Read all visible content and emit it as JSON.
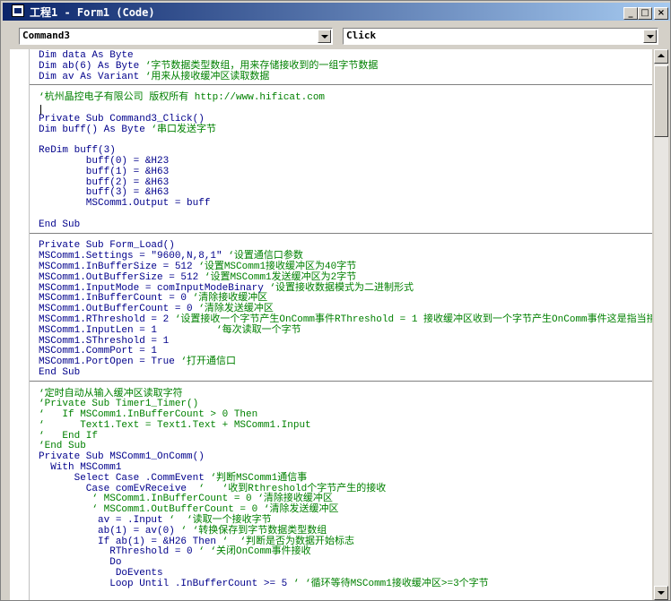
{
  "window": {
    "title": "工程1 - Form1 (Code)",
    "buttons": {
      "minimize": "_",
      "maximize": "□",
      "close": "×"
    }
  },
  "object_combo": {
    "value": "Command3"
  },
  "procedure_combo": {
    "value": "Click"
  },
  "code": {
    "sections": [
      [
        {
          "c": "Dim data As Byte",
          "t": "kw"
        },
        {
          "c": "Dim ab(6) As Byte ‘字节数据类型数组，用来存储接收到的一组字节数据",
          "t": "mix"
        },
        {
          "c": "Dim av As Variant ‘用来从接收缓冲区读取数据",
          "t": "mix"
        }
      ],
      [
        {
          "c": "",
          "t": "kw"
        },
        {
          "c": "‘杭州晶控电子有限公司 版权所有 http://www.hificat.com",
          "t": "cm"
        },
        {
          "c": "",
          "t": "kw"
        },
        {
          "c": "Private Sub Command3_Click()",
          "t": "kw"
        },
        {
          "c": "Dim buff() As Byte ‘串口发送字节",
          "t": "mix"
        },
        {
          "c": "",
          "t": "kw"
        },
        {
          "c": "ReDim buff(3)",
          "t": "kw"
        },
        {
          "c": "        buff(0) = &H23",
          "t": "kw"
        },
        {
          "c": "        buff(1) = &H63",
          "t": "kw"
        },
        {
          "c": "        buff(2) = &H63",
          "t": "kw"
        },
        {
          "c": "        buff(3) = &H63",
          "t": "kw"
        },
        {
          "c": "        MSComm1.Output = buff",
          "t": "kw"
        },
        {
          "c": "",
          "t": "kw"
        },
        {
          "c": "End Sub",
          "t": "kw"
        }
      ],
      [
        {
          "c": "",
          "t": "kw"
        },
        {
          "c": "Private Sub Form_Load()",
          "t": "kw"
        },
        {
          "c": "MSComm1.Settings = \"9600,N,8,1\" ‘设置通信口参数",
          "t": "mix"
        },
        {
          "c": "MSComm1.InBufferSize = 512 ‘设置MSComm1接收缓冲区为40字节",
          "t": "mix"
        },
        {
          "c": "MSComm1.OutBufferSize = 512 ‘设置MSComm1发送缓冲区为2字节",
          "t": "mix"
        },
        {
          "c": "MSComm1.InputMode = comInputModeBinary ‘设置接收数据模式为二进制形式",
          "t": "mix"
        },
        {
          "c": "MSComm1.InBufferCount = 0 ‘清除接收缓冲区",
          "t": "mix"
        },
        {
          "c": "MSComm1.OutBufferCount = 0 ‘清除发送缓冲区",
          "t": "mix"
        },
        {
          "c": "MSComm1.RThreshold = 2 ‘设置接收一个字节产生OnComm事件RThreshold = 1 接收缓冲区收到一个字节产生OnComm事件这是指当接",
          "t": "mix"
        },
        {
          "c": "MSComm1.InputLen = 1          ‘每次读取一个字节",
          "t": "mix"
        },
        {
          "c": "MSComm1.SThreshold = 1",
          "t": "kw"
        },
        {
          "c": "MSComm1.CommPort = 1",
          "t": "kw"
        },
        {
          "c": "MSComm1.PortOpen = True ‘打开通信口",
          "t": "mix"
        },
        {
          "c": "End Sub",
          "t": "kw"
        }
      ],
      [
        {
          "c": "",
          "t": "kw"
        },
        {
          "c": "‘定时自动从输入缓冲区读取字符",
          "t": "cm"
        },
        {
          "c": "‘Private Sub Timer1_Timer()",
          "t": "cm"
        },
        {
          "c": "‘   If MSComm1.InBufferCount > 0 Then",
          "t": "cm"
        },
        {
          "c": "‘      Text1.Text = Text1.Text + MSComm1.Input",
          "t": "cm"
        },
        {
          "c": "‘   End If",
          "t": "cm"
        },
        {
          "c": "‘End Sub",
          "t": "cm"
        },
        {
          "c": "Private Sub MSComm1_OnComm()",
          "t": "kw"
        },
        {
          "c": "  With MSComm1",
          "t": "kw"
        },
        {
          "c": "      Select Case .CommEvent ‘判断MSComm1通信事",
          "t": "mix"
        },
        {
          "c": "        Case comEvReceive  ‘   ‘收到Rthreshold个字节产生的接收",
          "t": "mix"
        },
        {
          "c": "         ‘ MSComm1.InBufferCount = 0 ‘清除接收缓冲区",
          "t": "cm"
        },
        {
          "c": "         ‘ MSComm1.OutBufferCount = 0 ‘清除发送缓冲区",
          "t": "cm"
        },
        {
          "c": "          av = .Input ‘  ‘读取一个接收字节",
          "t": "mix"
        },
        {
          "c": "          ab(1) = av(0) ‘ ‘转换保存到字节数据类型数组",
          "t": "mix"
        },
        {
          "c": "          If ab(1) = &H26 Then ‘  ‘判断是否为数据开始标志",
          "t": "mix"
        },
        {
          "c": "            RThreshold = 0 ‘ ‘关闭OnComm事件接收",
          "t": "mix"
        },
        {
          "c": "            Do",
          "t": "kw"
        },
        {
          "c": "             DoEvents",
          "t": "kw"
        },
        {
          "c": "            Loop Until .InBufferCount >= 5 ‘ ‘循环等待MSComm1接收缓冲区>=3个字节",
          "t": "mix"
        }
      ]
    ]
  }
}
